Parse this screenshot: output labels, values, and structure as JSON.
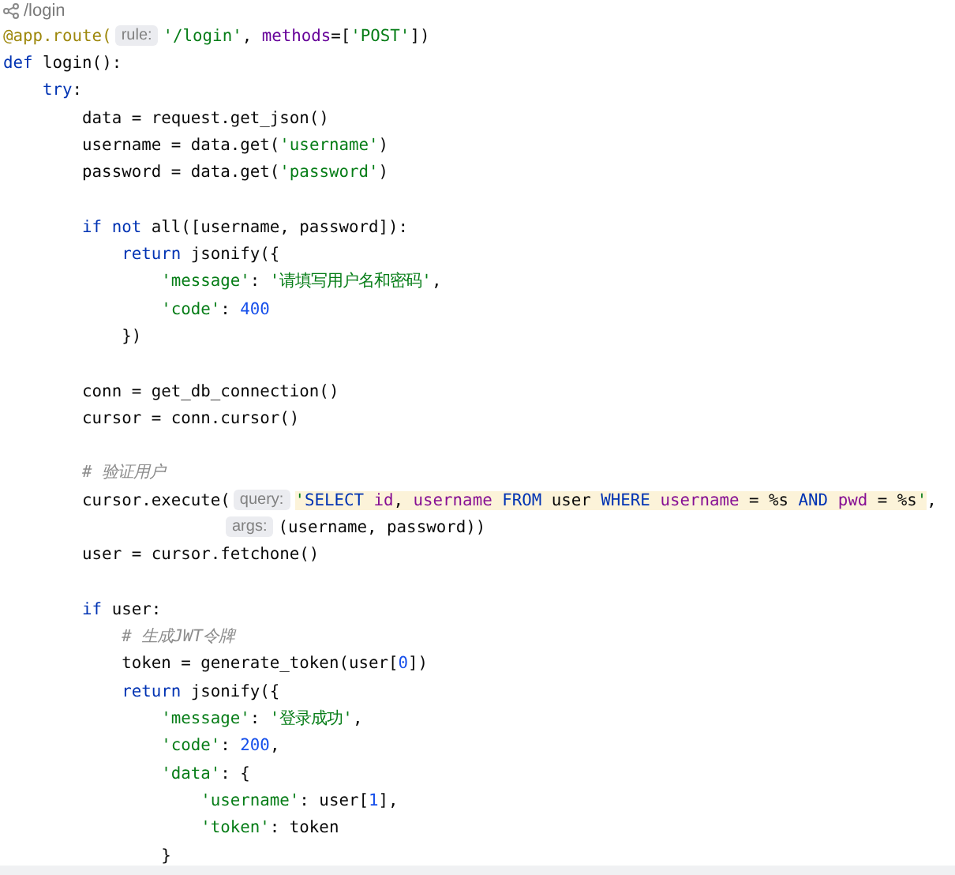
{
  "breadcrumb": {
    "text": "/login"
  },
  "lines": [
    {
      "tokens": [
        {
          "kind": "decorator",
          "text": "@app.route("
        },
        {
          "kind": "hint",
          "text": "rule:"
        },
        {
          "kind": "string",
          "text": "'/login'"
        },
        {
          "kind": "plain",
          "text": ", "
        },
        {
          "kind": "kwarg",
          "text": "methods"
        },
        {
          "kind": "plain",
          "text": "=["
        },
        {
          "kind": "string",
          "text": "'POST'"
        },
        {
          "kind": "plain",
          "text": "])"
        }
      ]
    },
    {
      "tokens": [
        {
          "kind": "keyword",
          "text": "def "
        },
        {
          "kind": "plain",
          "text": "login():"
        }
      ]
    },
    {
      "tokens": [
        {
          "kind": "keyword",
          "text": "    try"
        },
        {
          "kind": "plain",
          "text": ":"
        }
      ]
    },
    {
      "tokens": [
        {
          "kind": "plain",
          "text": "        data = request.get_json()"
        }
      ]
    },
    {
      "tokens": [
        {
          "kind": "plain",
          "text": "        username = data.get("
        },
        {
          "kind": "string",
          "text": "'username'"
        },
        {
          "kind": "plain",
          "text": ")"
        }
      ]
    },
    {
      "tokens": [
        {
          "kind": "plain",
          "text": "        password = data.get("
        },
        {
          "kind": "string",
          "text": "'password'"
        },
        {
          "kind": "plain",
          "text": ")"
        }
      ]
    },
    {
      "blank_before": true,
      "tokens": [
        {
          "kind": "keyword",
          "text": "        if not "
        },
        {
          "kind": "plain",
          "text": "all([username, password]):"
        }
      ]
    },
    {
      "tokens": [
        {
          "kind": "keyword",
          "text": "            return "
        },
        {
          "kind": "plain",
          "text": "jsonify({"
        }
      ]
    },
    {
      "tokens": [
        {
          "kind": "string",
          "text": "                'message'"
        },
        {
          "kind": "plain",
          "text": ": "
        },
        {
          "kind": "string",
          "text": "'请填写用户名和密码'"
        },
        {
          "kind": "plain",
          "text": ","
        }
      ]
    },
    {
      "tokens": [
        {
          "kind": "string",
          "text": "                'code'"
        },
        {
          "kind": "plain",
          "text": ": "
        },
        {
          "kind": "number",
          "text": "400"
        }
      ]
    },
    {
      "tokens": [
        {
          "kind": "plain",
          "text": "            })"
        }
      ]
    },
    {
      "blank_before": true,
      "tokens": [
        {
          "kind": "plain",
          "text": "        conn = get_db_connection()"
        }
      ]
    },
    {
      "tokens": [
        {
          "kind": "plain",
          "text": "        cursor = conn.cursor()"
        }
      ]
    },
    {
      "blank_before": true,
      "tokens": [
        {
          "kind": "comment",
          "text": "        # 验证用户"
        }
      ]
    },
    {
      "tokens": [
        {
          "kind": "plain",
          "text": "        cursor.execute("
        },
        {
          "kind": "hint",
          "text": "query:"
        },
        {
          "kind": "sql_string",
          "text": "'"
        },
        {
          "kind": "sql_keyword",
          "text": "SELECT "
        },
        {
          "kind": "sql_name",
          "text": "id"
        },
        {
          "kind": "sql_plain",
          "text": ", "
        },
        {
          "kind": "sql_name",
          "text": "username "
        },
        {
          "kind": "sql_keyword",
          "text": "FROM "
        },
        {
          "kind": "sql_plain",
          "text": "user "
        },
        {
          "kind": "sql_keyword",
          "text": "WHERE "
        },
        {
          "kind": "sql_name",
          "text": "username "
        },
        {
          "kind": "sql_plain",
          "text": "= %s "
        },
        {
          "kind": "sql_keyword",
          "text": "AND "
        },
        {
          "kind": "sql_name",
          "text": "pwd "
        },
        {
          "kind": "sql_plain",
          "text": "= %s"
        },
        {
          "kind": "sql_string",
          "text": "'"
        },
        {
          "kind": "plain",
          "text": ","
        }
      ]
    },
    {
      "tokens": [
        {
          "kind": "hint",
          "text": "args:"
        },
        {
          "kind": "plain",
          "text": "(username, password))"
        }
      ]
    },
    {
      "tokens": [
        {
          "kind": "plain",
          "text": "        user = cursor.fetchone()"
        }
      ]
    },
    {
      "blank_before": true,
      "tokens": [
        {
          "kind": "keyword",
          "text": "        if "
        },
        {
          "kind": "plain",
          "text": "user:"
        }
      ]
    },
    {
      "tokens": [
        {
          "kind": "comment",
          "text": "            # 生成JWT令牌"
        }
      ]
    },
    {
      "tokens": [
        {
          "kind": "plain",
          "text": "            token = generate_token(user["
        },
        {
          "kind": "number",
          "text": "0"
        },
        {
          "kind": "plain",
          "text": "])"
        }
      ]
    },
    {
      "tokens": [
        {
          "kind": "keyword",
          "text": "            return "
        },
        {
          "kind": "plain",
          "text": "jsonify({"
        }
      ]
    },
    {
      "tokens": [
        {
          "kind": "string",
          "text": "                'message'"
        },
        {
          "kind": "plain",
          "text": ": "
        },
        {
          "kind": "string",
          "text": "'登录成功'"
        },
        {
          "kind": "plain",
          "text": ","
        }
      ]
    },
    {
      "tokens": [
        {
          "kind": "string",
          "text": "                'code'"
        },
        {
          "kind": "plain",
          "text": ": "
        },
        {
          "kind": "number",
          "text": "200"
        },
        {
          "kind": "plain",
          "text": ","
        }
      ]
    },
    {
      "tokens": [
        {
          "kind": "string",
          "text": "                'data'"
        },
        {
          "kind": "plain",
          "text": ": {"
        }
      ]
    },
    {
      "tokens": [
        {
          "kind": "string",
          "text": "                    'username'"
        },
        {
          "kind": "plain",
          "text": ": user["
        },
        {
          "kind": "number",
          "text": "1"
        },
        {
          "kind": "plain",
          "text": "],"
        }
      ]
    },
    {
      "tokens": [
        {
          "kind": "string",
          "text": "                    'token'"
        },
        {
          "kind": "plain",
          "text": ": token"
        }
      ]
    },
    {
      "tokens": [
        {
          "kind": "plain",
          "text": "                }"
        }
      ]
    }
  ]
}
